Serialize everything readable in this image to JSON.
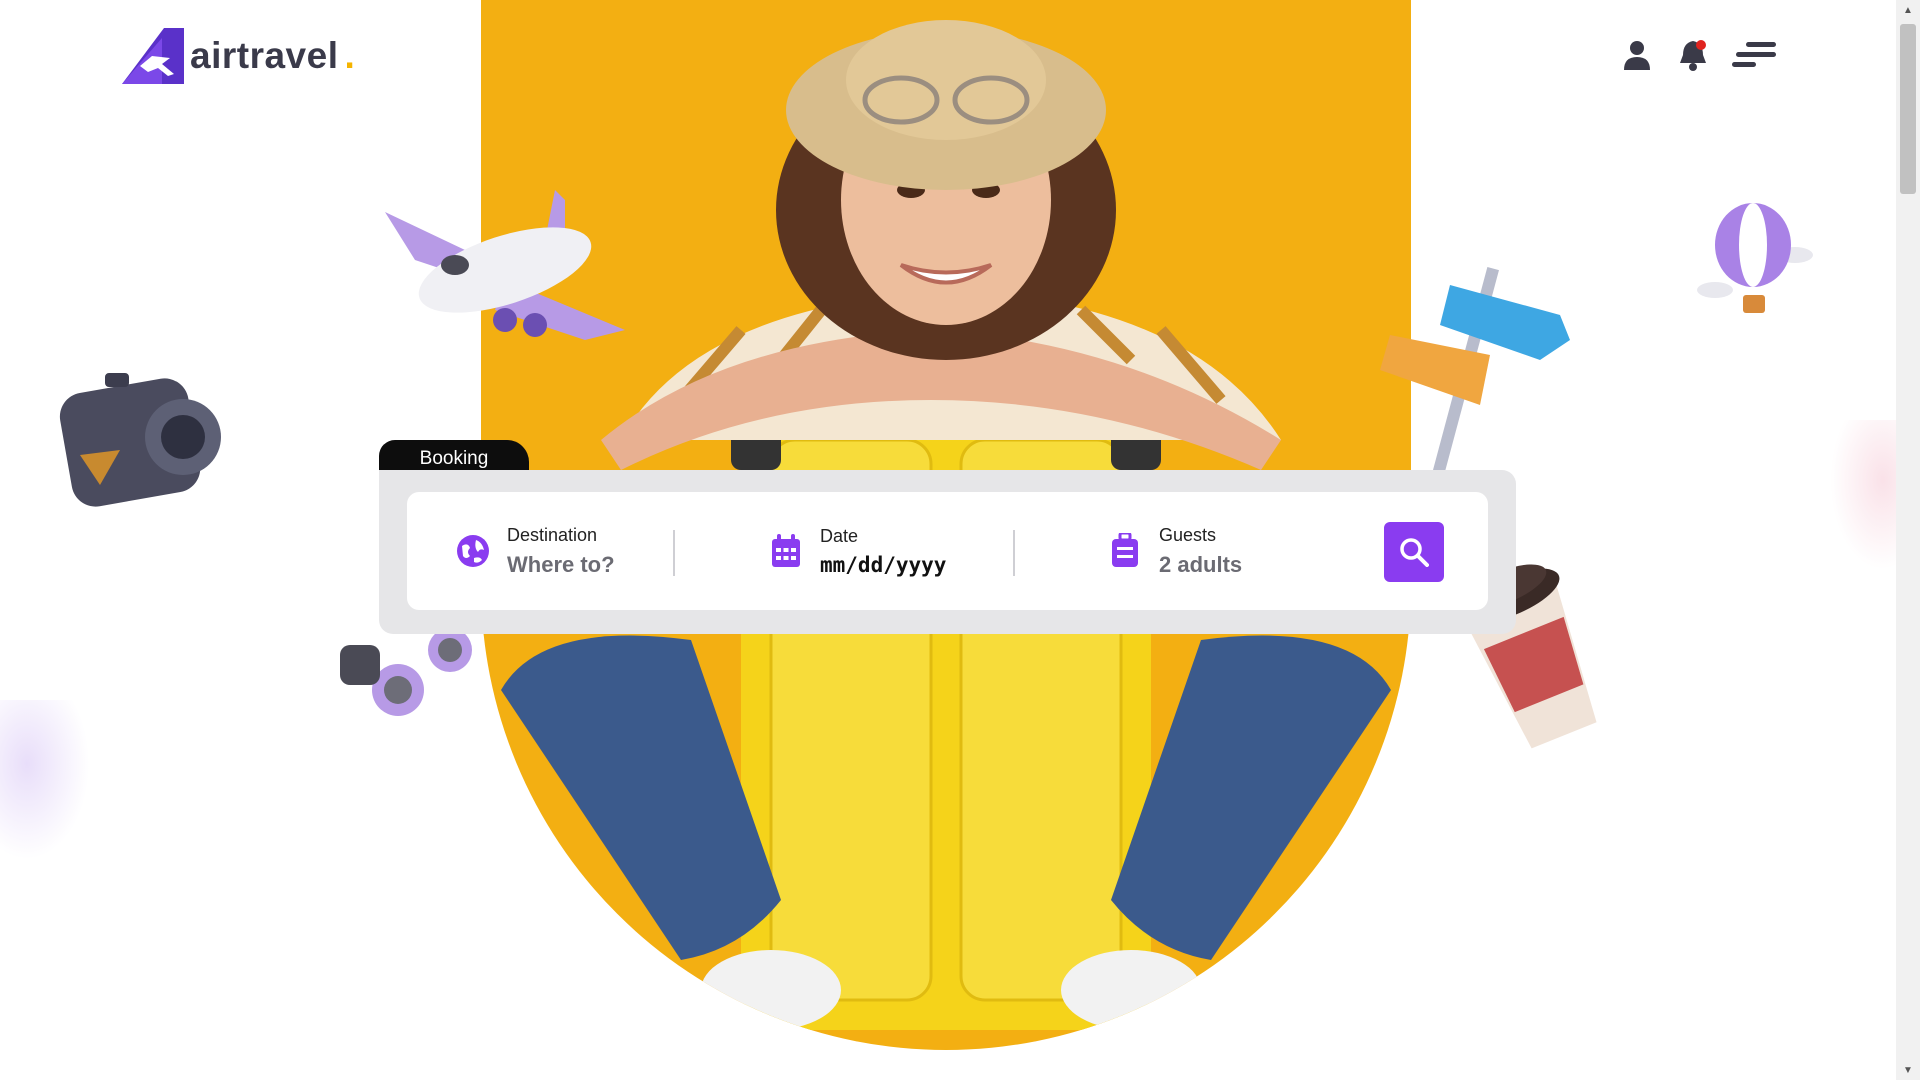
{
  "brand": {
    "name": "airtravel",
    "dot": ".",
    "accent": "#8a3cf0",
    "dot_color": "#f5b400"
  },
  "header": {
    "icons": [
      "user-icon",
      "bell-icon",
      "menu-icon"
    ]
  },
  "booking": {
    "tab_label": "Booking",
    "destination": {
      "label": "Destination",
      "placeholder": "Where to?",
      "icon": "globe-icon"
    },
    "date": {
      "label": "Date",
      "placeholder": "mm/dd/yyyy",
      "icon": "calendar-icon"
    },
    "guests": {
      "label": "Guests",
      "value": "2 adults",
      "icon": "luggage-icon"
    },
    "search_icon": "search-icon"
  },
  "colors": {
    "hero_bg": "#f3af12",
    "panel_bg": "#e6e6e8",
    "tab_bg": "#0d0d0d"
  }
}
